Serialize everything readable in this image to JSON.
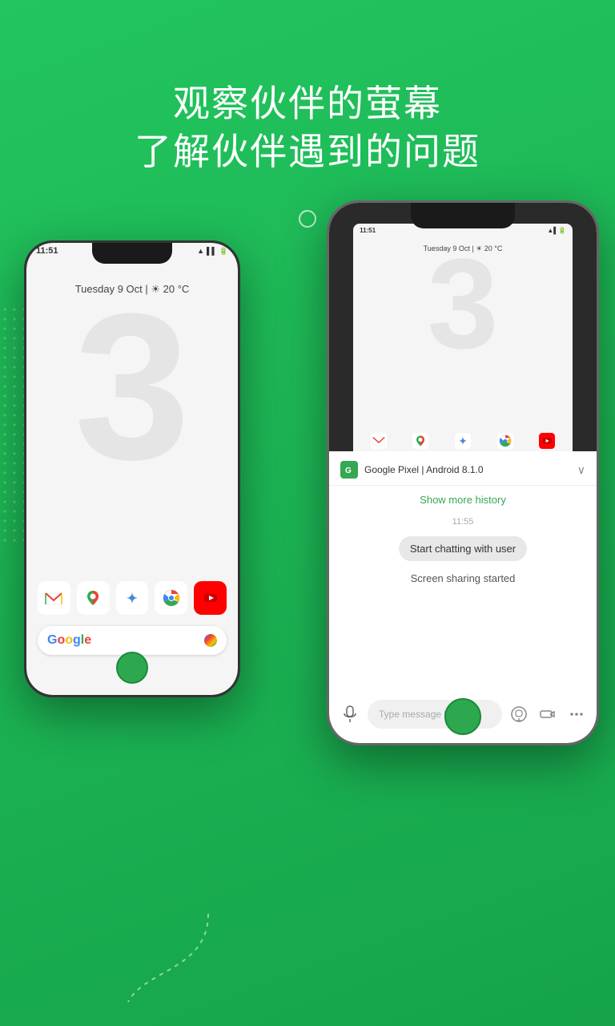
{
  "app": {
    "bg_color": "#1db954"
  },
  "header": {
    "line1": "观察伙伴的萤幕",
    "line2": "了解伙伴遇到的问题"
  },
  "phone_left": {
    "status_time": "11:51",
    "date_info": "Tuesday 9 Oct | ☀ 20 °C",
    "big_number": "3",
    "app_icons": [
      "M",
      "📍",
      "🎨",
      "◎",
      "▶"
    ],
    "google_placeholder": "G"
  },
  "phone_right": {
    "status_time": "11:51",
    "date_info": "Tuesday 9 Oct | ☀ 20 °C",
    "big_number": "3",
    "device_info": "Google Pixel | Android 8.1.0",
    "chat": {
      "show_history": "Show more history",
      "timestamp": "11:55",
      "bubble_text": "Start chatting with user",
      "screen_sharing": "Screen sharing started",
      "input_placeholder": "Type message here"
    },
    "app_icons": [
      "M",
      "📍",
      "🎨",
      "◎",
      "▶"
    ]
  }
}
